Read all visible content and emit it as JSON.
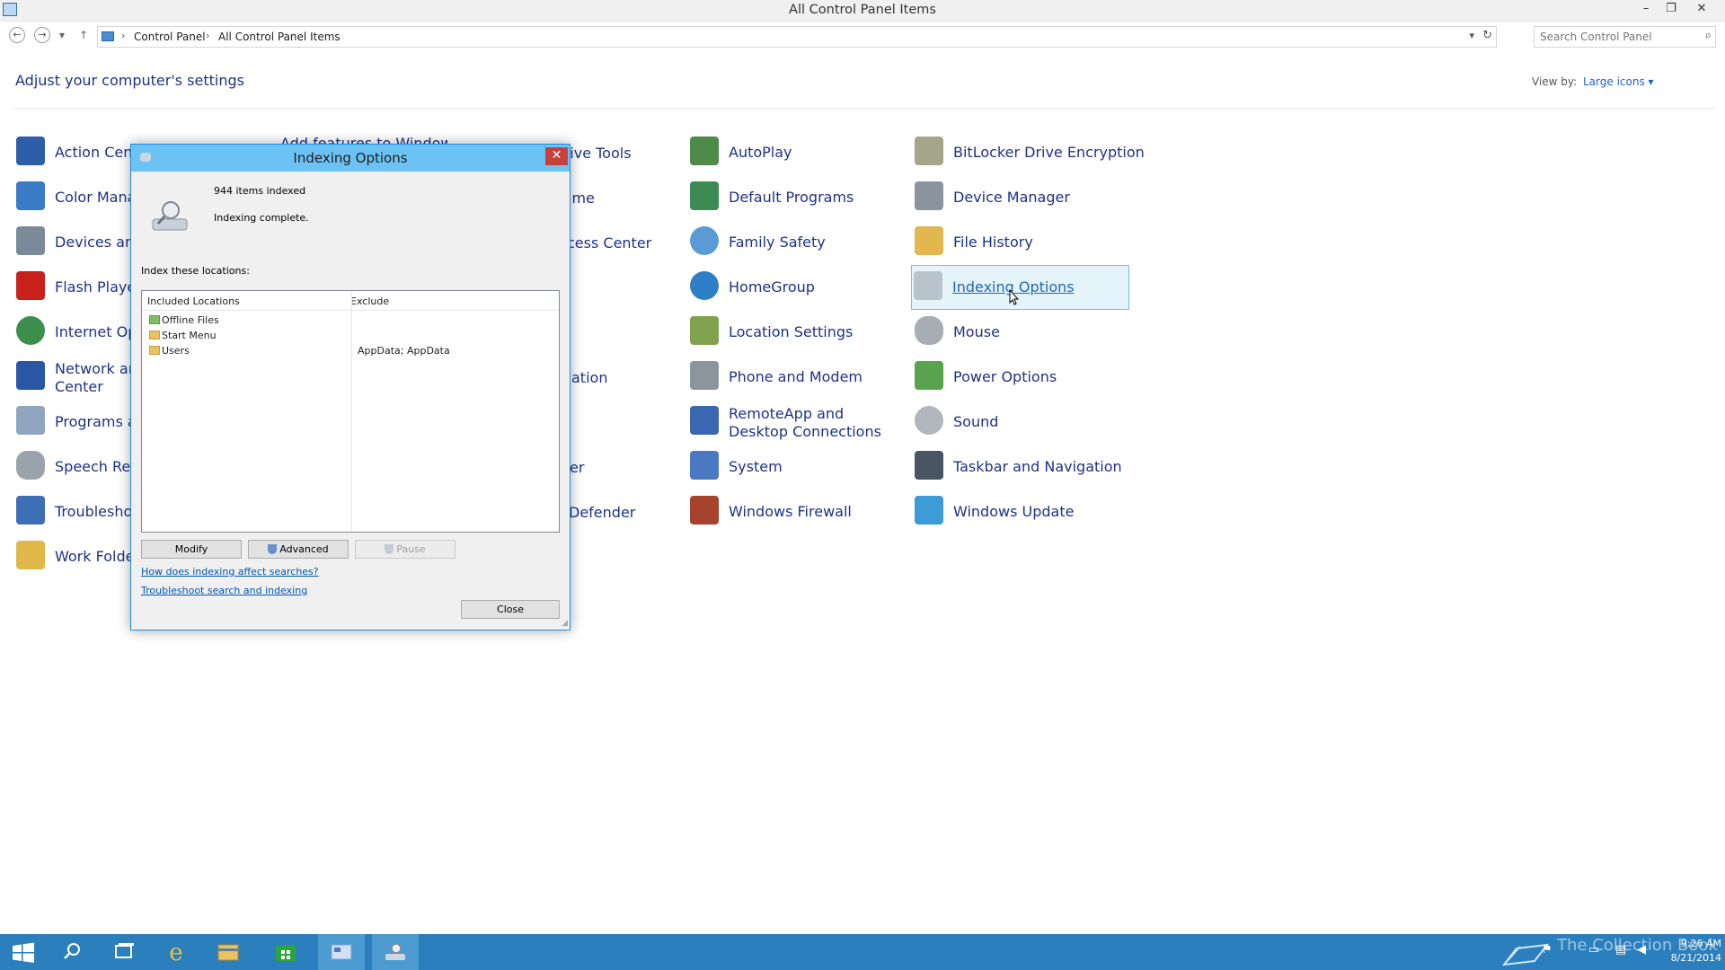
{
  "window": {
    "title": "All Control Panel Items",
    "minimize": "–",
    "restore": "❐",
    "close": "✕"
  },
  "nav": {
    "back": "←",
    "forward": "→",
    "recent": "▾",
    "up": "↑",
    "breadcrumb": [
      "Control Panel",
      "All Control Panel Items"
    ],
    "separator": "›",
    "dropdown": "▾",
    "refresh": "↻",
    "search_placeholder": "Search Control Panel",
    "search_icon": "⌕"
  },
  "header": {
    "title": "Adjust your computer's settings",
    "view_by_label": "View by:",
    "view_by_value": "Large icons ▾"
  },
  "items": {
    "col1": [
      "Action Cente",
      "Color Mana",
      "Devices and",
      "Flash Player",
      "Internet Opt",
      "Network an\nCenter",
      "Programs ar",
      "Speech Reco",
      "Troubleshoo",
      "Work Folder"
    ],
    "col2_partial": [
      "Add features to Windows"
    ],
    "col3_partial": [
      "tive Tools",
      "ime",
      "cess Center",
      "ation",
      "er",
      "Defender"
    ],
    "col4": [
      "AutoPlay",
      "Default Programs",
      "Family Safety",
      "HomeGroup",
      "Location Settings",
      "Phone and Modem",
      "RemoteApp and Desktop Connections",
      "System",
      "Windows Firewall"
    ],
    "col5": [
      "BitLocker Drive Encryption",
      "Device Manager",
      "File History",
      "Indexing Options",
      "Mouse",
      "Power Options",
      "Sound",
      "Taskbar and Navigation",
      "Windows Update"
    ]
  },
  "dialog": {
    "title": "Indexing Options",
    "close": "✕",
    "items_indexed": "944 items indexed",
    "status": "Indexing complete.",
    "locations_label": "Index these locations:",
    "columns": [
      "Included Locations",
      "Exclude"
    ],
    "rows": [
      {
        "name": "Offline Files",
        "exclude": ""
      },
      {
        "name": "Start Menu",
        "exclude": ""
      },
      {
        "name": "Users",
        "exclude": "AppData; AppData"
      }
    ],
    "buttons": {
      "modify": "Modify",
      "advanced": "Advanced",
      "pause": "Pause",
      "close": "Close"
    },
    "links": [
      "How does indexing affect searches?",
      "Troubleshoot search and indexing"
    ]
  },
  "taskbar": {
    "time": "9:26 AM",
    "date": "8/21/2014",
    "watermark": "The Collection Book"
  },
  "colors": {
    "accent": "#1e3287",
    "titlebar_dialog": "#6cc3f3",
    "taskbar": "#2a7fbc",
    "hover_bg": "#e5f3fb"
  }
}
